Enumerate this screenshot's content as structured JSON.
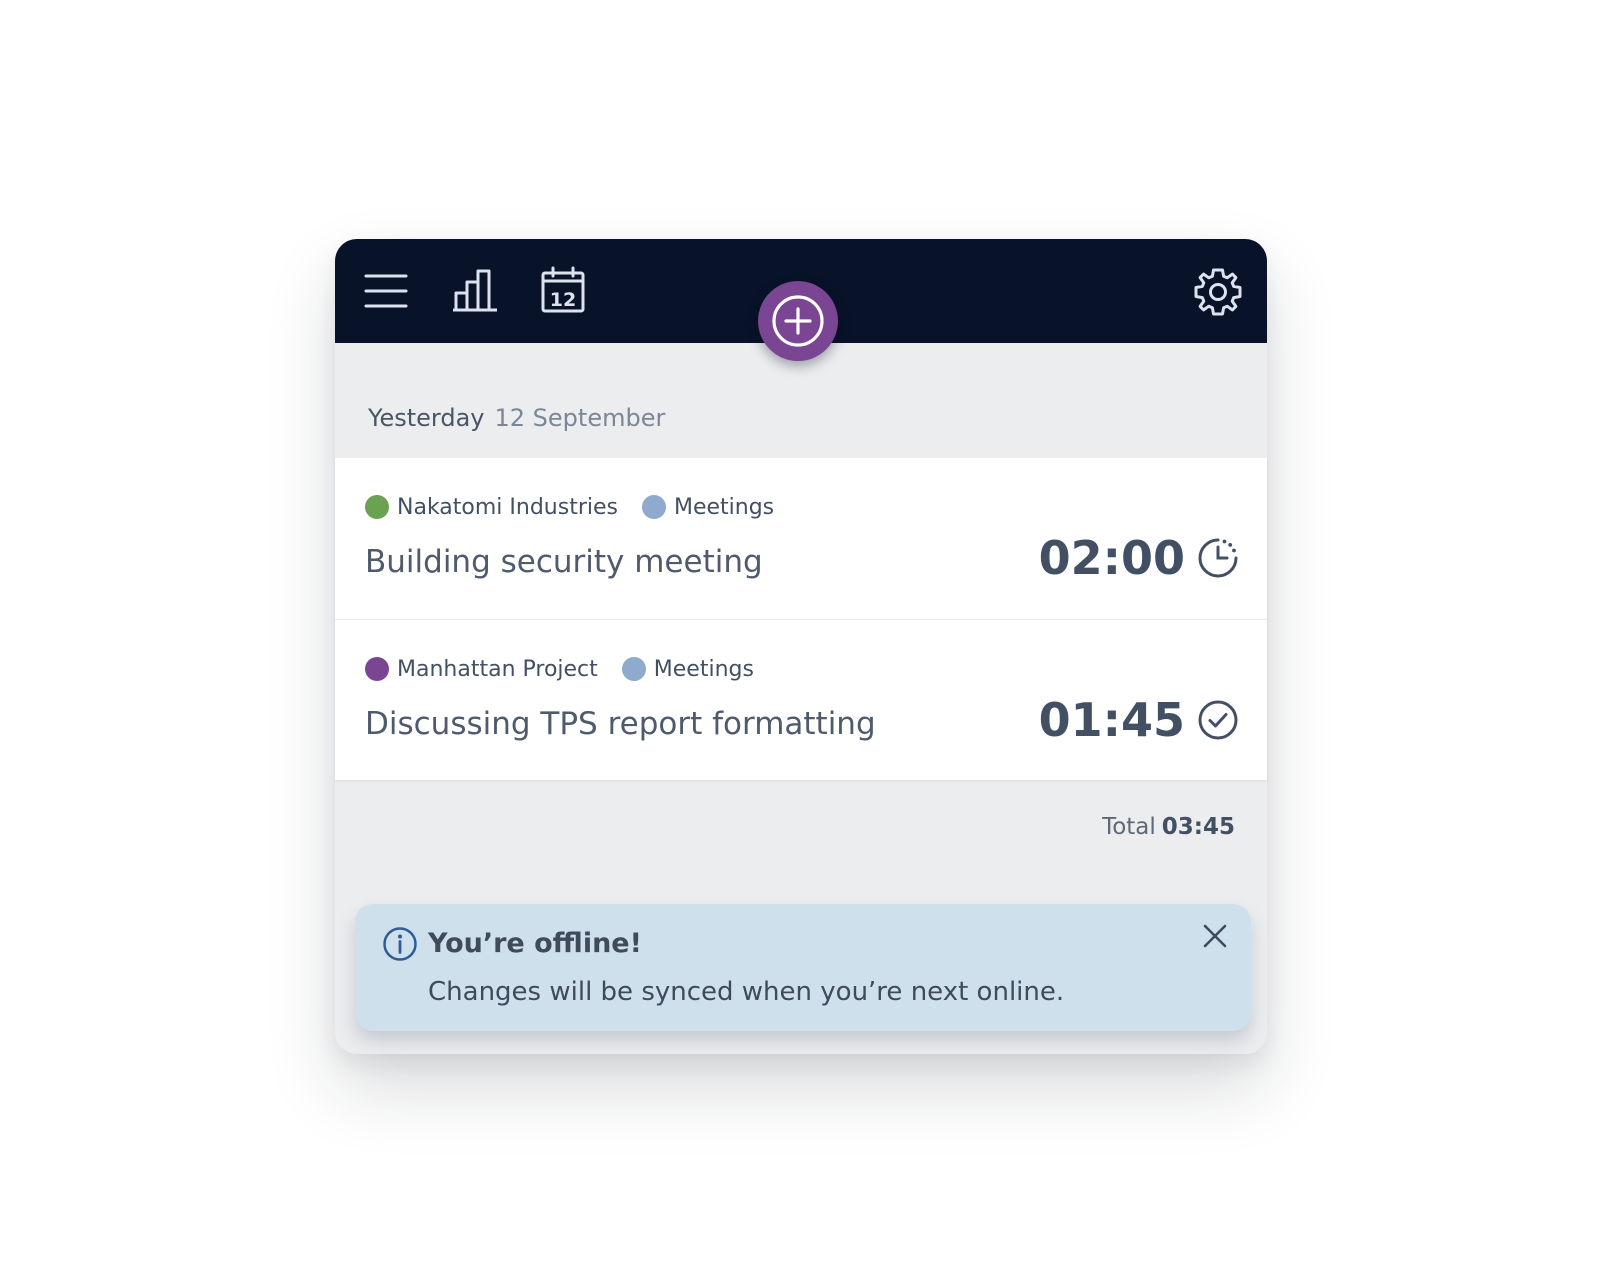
{
  "topbar": {
    "menu_icon": "hamburger-menu-icon",
    "reports_icon": "bar-chart-icon",
    "calendar_icon": "calendar-icon",
    "calendar_day": "12",
    "add_icon": "plus-circle-icon",
    "settings_icon": "gear-icon",
    "background_color": "#081228",
    "add_button_color": "#7a4593"
  },
  "day": {
    "name": "Yesterday",
    "date": "12 September"
  },
  "entries": [
    {
      "client": "Nakatomi Industries",
      "client_color": "#6aa251",
      "task": "Meetings",
      "task_color": "#8eaacd",
      "description": "Building security meeting",
      "duration": "02:00",
      "status_icon": "timer-running-icon"
    },
    {
      "client": "Manhattan Project",
      "client_color": "#7a4593",
      "task": "Meetings",
      "task_color": "#8eaacd",
      "description": "Discussing TPS report formatting",
      "duration": "01:45",
      "status_icon": "check-circle-icon"
    }
  ],
  "total": {
    "label": "Total",
    "value": "03:45"
  },
  "notification": {
    "icon": "info-circle-icon",
    "title": "You’re offline!",
    "message": "Changes will be synced when you’re next online.",
    "close_icon": "close-icon",
    "background_color": "#cfe0ed"
  }
}
